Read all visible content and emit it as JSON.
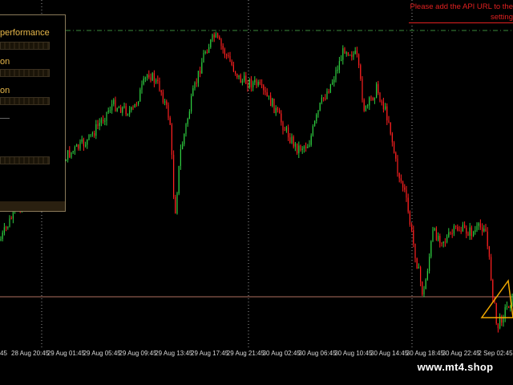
{
  "chart_data": {
    "type": "candlestick",
    "x": [
      "28 Aug 20:45",
      "29 Aug 01:45",
      "29 Aug 05:45",
      "29 Aug 09:45",
      "29 Aug 13:45",
      "29 Aug 17:45",
      "29 Aug 21:45",
      "30 Aug 02:45",
      "30 Aug 06:45",
      "30 Aug 10:45",
      "30 Aug 14:45",
      "30 Aug 18:45",
      "30 Aug 22:45",
      "2 Sep 02:45"
    ],
    "partial_first_label": "45",
    "colors": {
      "up": "#2ecc40",
      "down": "#ff2020",
      "grid": "#9a9a9a",
      "hline": "#b07060",
      "dashline": "#3a8a3a",
      "signal": "#f0a800"
    }
  },
  "panel": {
    "line1": "performance",
    "line2": "on",
    "line3": "on"
  },
  "notice": {
    "line1": "Please add the API URL to the",
    "line2": "setting"
  },
  "watermark": "www.mt4.shop"
}
